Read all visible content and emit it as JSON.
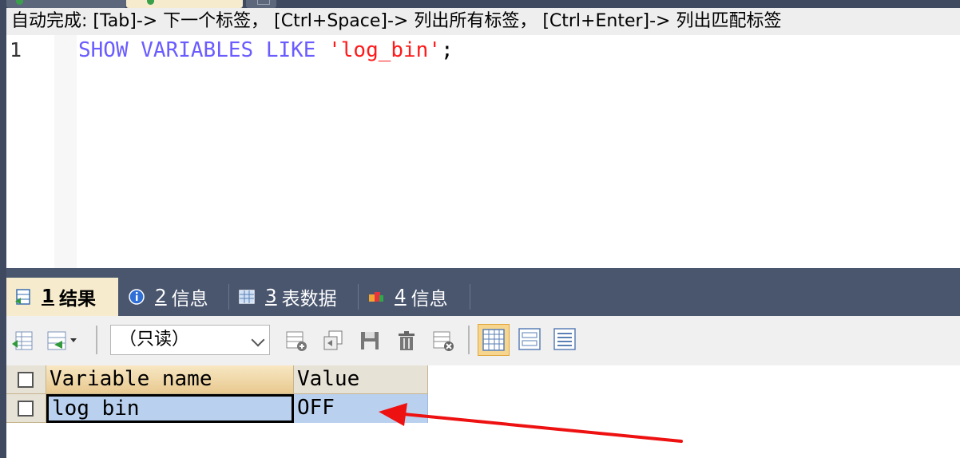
{
  "hint": {
    "text": "自动完成: [Tab]-> 下一个标签， [Ctrl+Space]-> 列出所有标签， [Ctrl+Enter]-> 列出匹配标签"
  },
  "editor": {
    "line_number": "1",
    "tokens": {
      "show": "SHOW",
      "variables": "VARIABLES",
      "like": "LIKE",
      "string": "'log_bin'",
      "semicolon": ";"
    },
    "colors": {
      "keyword": "#6a5cff",
      "string": "#ff1a1a"
    }
  },
  "result_tabs": [
    {
      "num": "1",
      "label": "结果",
      "active": true
    },
    {
      "num": "2",
      "label": "信息",
      "active": false
    },
    {
      "num": "3",
      "label": "表数据",
      "active": false
    },
    {
      "num": "4",
      "label": "信息",
      "active": false
    }
  ],
  "toolbar": {
    "mode_select": "（只读）"
  },
  "grid": {
    "columns": [
      "Variable name",
      "Value"
    ],
    "rows": [
      {
        "variable_name": "log bin",
        "value": "OFF"
      }
    ]
  },
  "annotation": {
    "color": "#ee1111",
    "shape": "arrow"
  }
}
